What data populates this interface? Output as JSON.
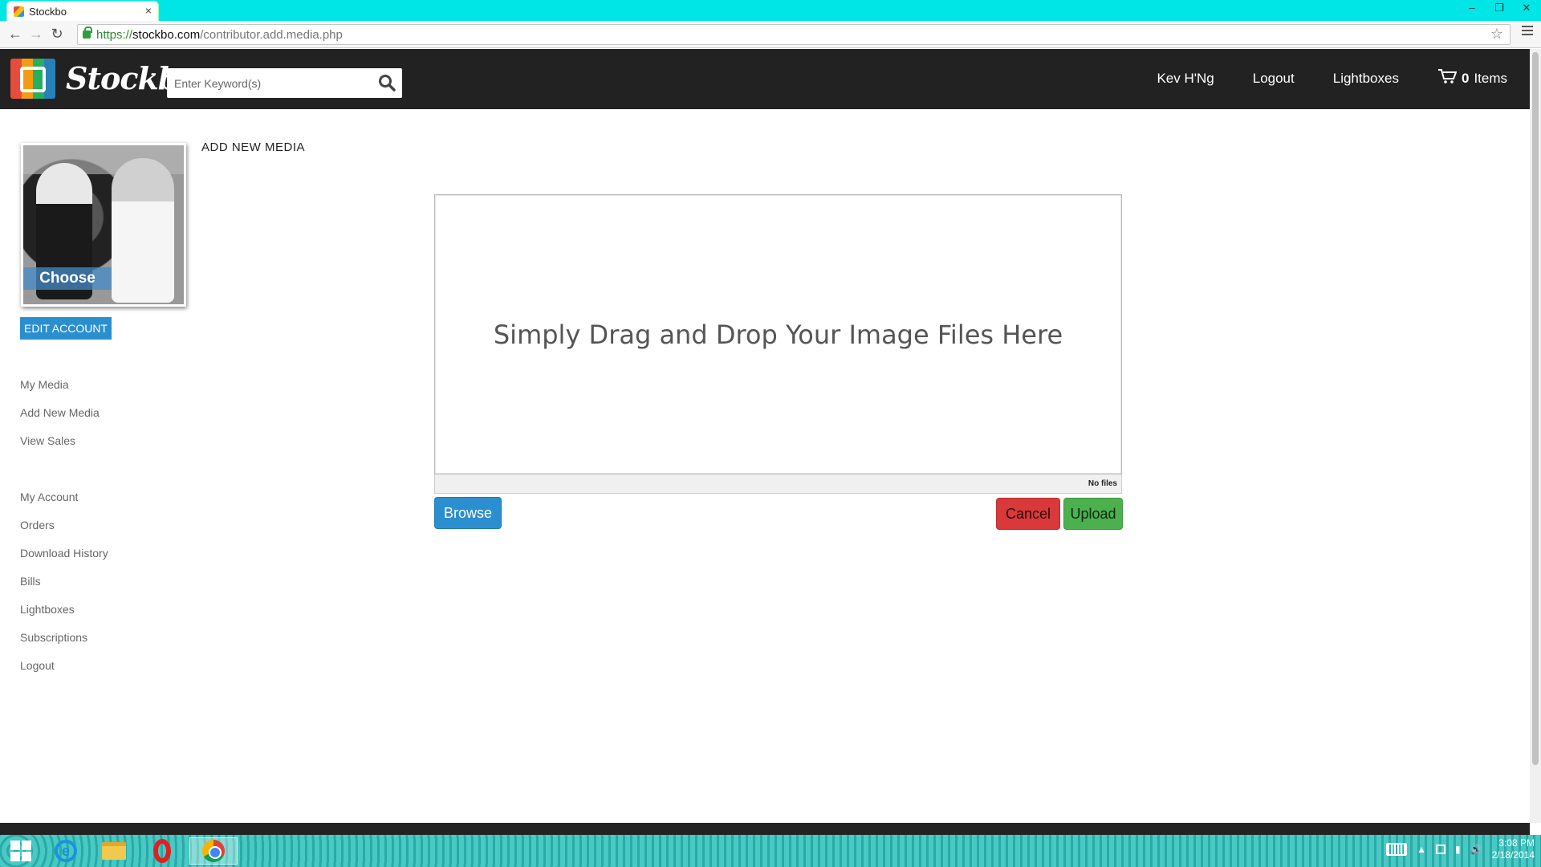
{
  "browser": {
    "tab_title": "Stockbo",
    "tab_close": "×",
    "url_scheme": "https://",
    "url_host": "stockbo.com",
    "url_path": "/contributor.add.media.php",
    "window_controls": [
      "–",
      "❐",
      "✕"
    ]
  },
  "header": {
    "logo_text": "Stockbo",
    "search_placeholder": "Enter Keyword(s)",
    "nav": {
      "user": "Kev H'Ng",
      "logout": "Logout",
      "lightboxes": "Lightboxes",
      "cart_count": "0",
      "cart_label": "Items"
    }
  },
  "sidebar": {
    "choose_label": "Choose",
    "edit_account": "EDIT ACCOUNT",
    "media_links": [
      "My Media",
      "Add New Media",
      "View Sales"
    ],
    "account_links": [
      "My Account",
      "Orders",
      "Download History",
      "Bills",
      "Lightboxes",
      "Subscriptions",
      "Logout"
    ]
  },
  "main": {
    "heading": "ADD NEW MEDIA",
    "dropzone_text": "Simply Drag and Drop Your Image Files Here",
    "file_status": "No files",
    "browse_label": "Browse",
    "cancel_label": "Cancel",
    "upload_label": "Upload"
  },
  "taskbar": {
    "time": "3:08 PM",
    "date": "2/18/2014"
  },
  "colors": {
    "browser_frame": "#00e5e5",
    "header_bg": "#222222",
    "primary_blue": "#2b8fcf",
    "cancel_red": "#d9393b",
    "upload_green": "#4cb04f"
  }
}
